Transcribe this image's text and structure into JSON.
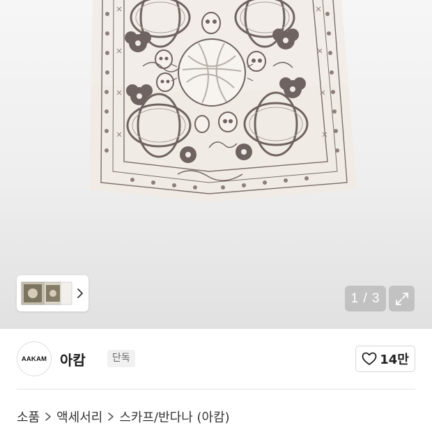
{
  "gallery": {
    "product_image_alt": "scarf-image",
    "thumbnail_count": 3,
    "page_counter": "1 / 3",
    "expand_icon": "expand-icon",
    "next_icon": "chevron-right-icon"
  },
  "brand": {
    "logo_text": "AAKAM",
    "name": "아캄",
    "badge": "단독"
  },
  "like": {
    "icon": "heart-icon",
    "count": "14만"
  },
  "breadcrumb": {
    "items": [
      "소품",
      "액세서리",
      "스카프/반다나 (아캄)"
    ],
    "separator_icon": "chevron-right-icon"
  },
  "colors": {
    "scarf_base": "#f1ebe6",
    "scarf_ink": "#6e6360",
    "counter_bg": "#9b9b9b",
    "divider": "#e3e3e3"
  }
}
